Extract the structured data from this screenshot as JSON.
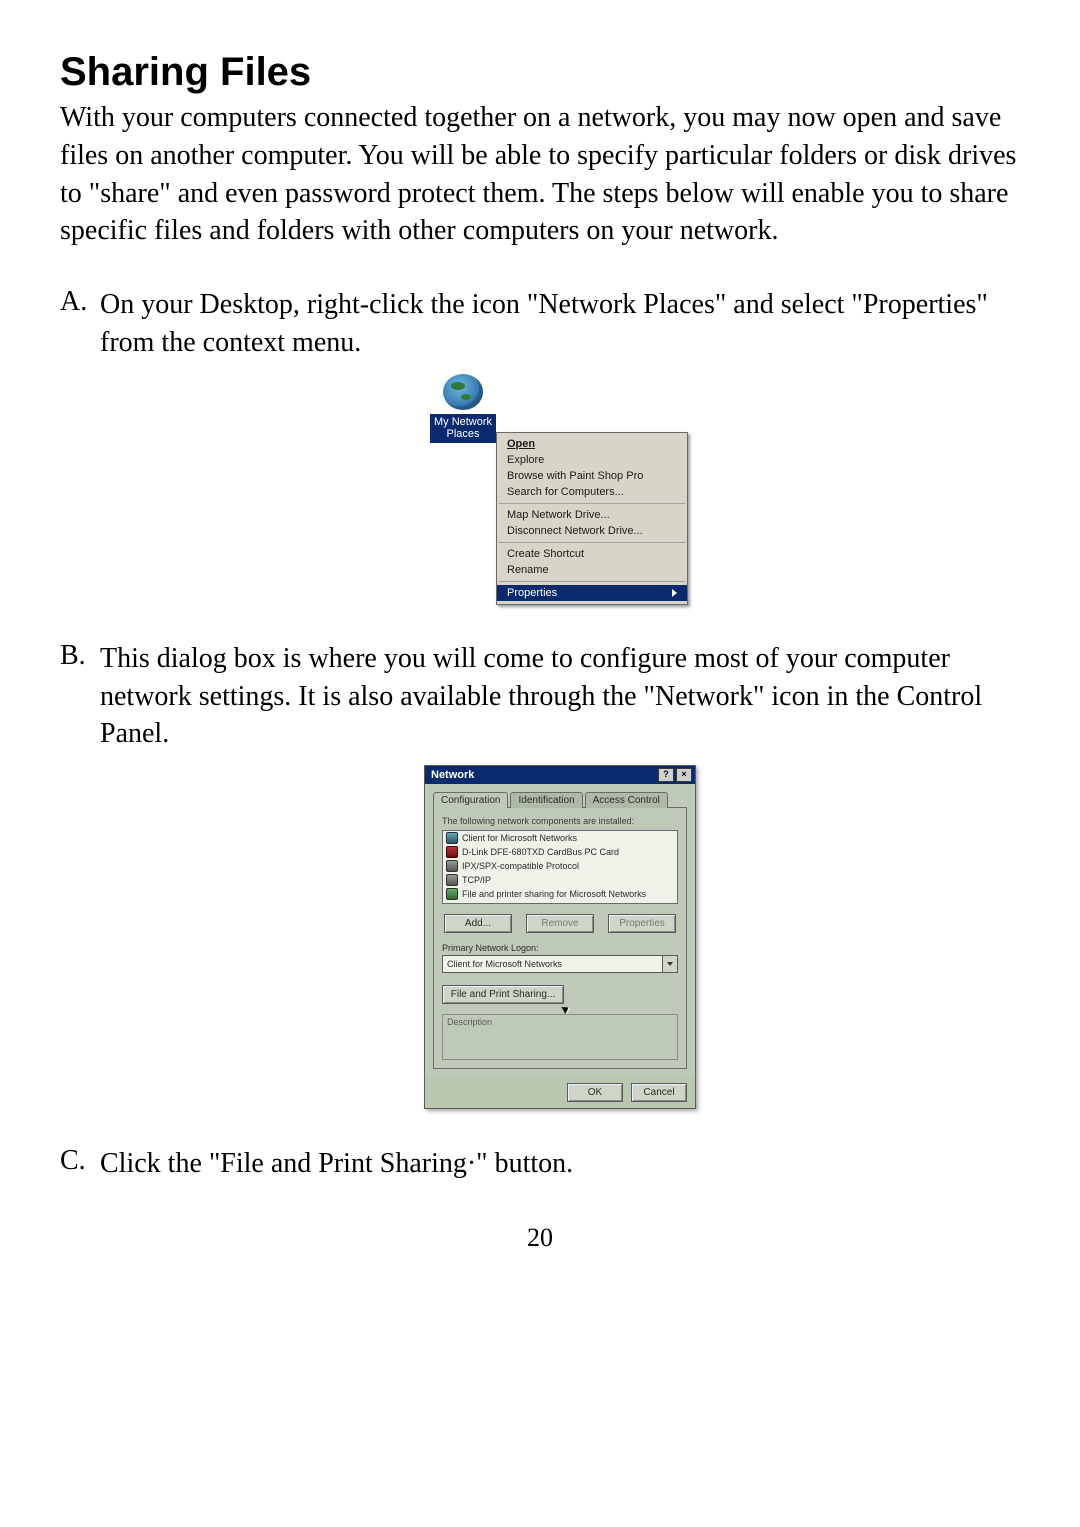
{
  "heading": "Sharing Files",
  "intro": "With your computers connected together on a network, you may now open and save files on another computer.  You will be able to specify particular folders or disk drives to \"share\" and even password protect them.  The steps below will enable you to share specific files and folders with other computers on your network.",
  "steps": {
    "a": {
      "label": "A.",
      "text": "On your Desktop, right-click the icon \"Network Places\" and select \"Properties\" from the context menu."
    },
    "b": {
      "label": "B.",
      "text": "This dialog box is where you will come to configure most of your computer network settings.  It is also available through the \"Network\" icon in the Control Panel."
    },
    "c": {
      "label": "C.",
      "text": "Click the \"File and Print Sharing·\" button."
    }
  },
  "fig1": {
    "icon_label": "My Network Places",
    "menu": {
      "open": "Open",
      "explore": "Explore",
      "browse_psp": "Browse with Paint Shop Pro",
      "search": "Search for Computers...",
      "map_drive": "Map Network Drive...",
      "disconnect_drive": "Disconnect Network Drive...",
      "create_shortcut": "Create Shortcut",
      "rename": "Rename",
      "properties": "Properties"
    }
  },
  "fig2": {
    "title": "Network",
    "titlebar": {
      "help": "?",
      "close": "×"
    },
    "tabs": {
      "configuration": "Configuration",
      "identification": "Identification",
      "access_control": "Access Control"
    },
    "hint": "The following network components are installed:",
    "components": [
      "Client for Microsoft Networks",
      "D-Link DFE-680TXD CardBus PC Card",
      "IPX/SPX-compatible Protocol",
      "TCP/IP",
      "File and printer sharing for Microsoft Networks"
    ],
    "buttons": {
      "add": "Add...",
      "remove": "Remove",
      "properties": "Properties"
    },
    "primary_logon_label": "Primary Network Logon:",
    "primary_logon_value": "Client for Microsoft Networks",
    "file_print_sharing": "File and Print Sharing...",
    "description_label": "Description",
    "ok": "OK",
    "cancel": "Cancel"
  },
  "page_number": "20"
}
